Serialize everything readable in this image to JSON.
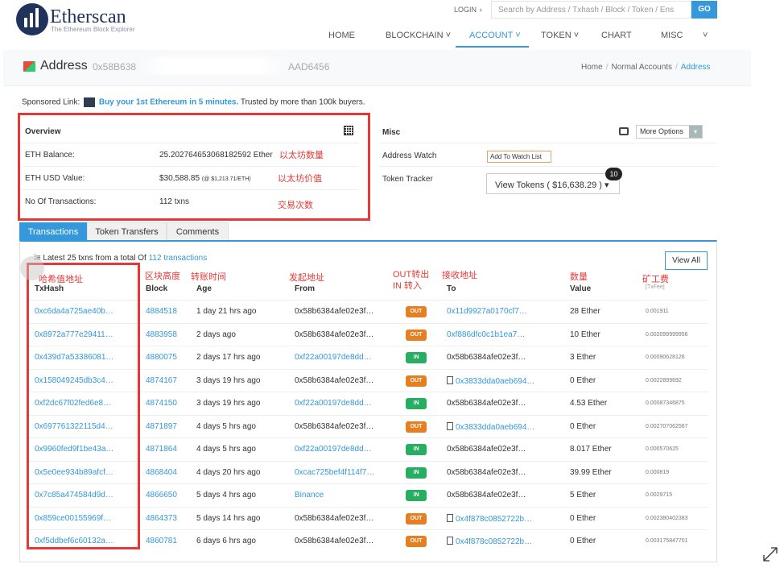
{
  "header": {
    "logo_name": "Etherscan",
    "logo_tagline": "The Ethereum Block Explorer",
    "login": "LOGIN",
    "search_placeholder": "Search by Address / Txhash / Block / Token / Ens",
    "go": "GO",
    "nav": [
      "HOME",
      "BLOCKCHAIN ˅",
      "ACCOUNT ˅",
      "TOKEN ˅",
      "CHART",
      "MISC",
      "˅"
    ]
  },
  "subheader": {
    "label": "Address",
    "address_prefix": "0x58B638",
    "address_suffix": "AAD6456",
    "breadcrumb": [
      "Home",
      "Normal Accounts",
      "Address"
    ]
  },
  "sponsor": {
    "prefix": "Sponsored Link:",
    "link": "Buy your 1st Ethereum in 5 minutes.",
    "suffix": "Trusted by more than 100k buyers."
  },
  "overview": {
    "title": "Overview",
    "rows": [
      {
        "label": "ETH Balance:",
        "value": "25.202764653068182592 Ether",
        "note": "以太坊数量"
      },
      {
        "label": "ETH USD Value:",
        "value": "$30,588.85",
        "sub": "(@ $1,213.71/ETH)",
        "note": "以太坊价值"
      },
      {
        "label": "No Of Transactions:",
        "value": "112 txns",
        "note": "交易次数"
      }
    ]
  },
  "misc": {
    "title": "Misc",
    "more_options": "More Options",
    "address_watch_label": "Address Watch",
    "watch_button": "Add To Watch List",
    "token_tracker_label": "Token Tracker",
    "tokens_select": "View Tokens ( $16,638.29 )",
    "tokens_badge": "10"
  },
  "tabs": [
    "Transactions",
    "Token Transfers",
    "Comments"
  ],
  "transactions": {
    "latest_prefix": "Latest 25 txns from a total Of",
    "latest_link": "112 transactions",
    "view_all": "View All",
    "annotations": {
      "txhash": "哈希值地址",
      "block": "区块高度",
      "age": "转账时间",
      "from": "发起地址",
      "direction": "OUT转出\nIN 转入",
      "to": "接收地址",
      "value": "数量",
      "fee": "矿工费"
    },
    "headers": {
      "txhash": "TxHash",
      "block": "Block",
      "age": "Age",
      "from": "From",
      "to": "To",
      "value": "Value",
      "fee": "[TxFee]"
    },
    "rows": [
      {
        "hash": "0xc6da4a725ae40b…",
        "block": "4884518",
        "age": "1 day 21 hrs ago",
        "from": "0x58b6384afe02e3f…",
        "dir": "OUT",
        "to": "0x11d9927a0170cf7…",
        "contract": false,
        "value": "28 Ether",
        "fee": "0.001911"
      },
      {
        "hash": "0x8972a777e29411…",
        "block": "4883958",
        "age": "2 days ago",
        "from": "0x58b6384afe02e3f…",
        "dir": "OUT",
        "to": "0xf886dfc0c1b1ea7…",
        "contract": false,
        "value": "10 Ether",
        "fee": "0.002099999956"
      },
      {
        "hash": "0x439d7a53386081…",
        "block": "4880075",
        "age": "2 days 17 hrs ago",
        "from": "0xf22a00197de8dd…",
        "dir": "IN",
        "to": "0x58b6384afe02e3f…",
        "contract": false,
        "value": "3 Ether",
        "fee": "0.00090628126"
      },
      {
        "hash": "0x158049245db3c4…",
        "block": "4874167",
        "age": "3 days 19 hrs ago",
        "from": "0x58b6384afe02e3f…",
        "dir": "OUT",
        "to": "0x3833dda0aeb694…",
        "contract": true,
        "value": "0 Ether",
        "fee": "0.0022899692"
      },
      {
        "hash": "0xf2dc67f02fed6e8…",
        "block": "4874150",
        "age": "3 days 19 hrs ago",
        "from": "0xf22a00197de8dd…",
        "dir": "IN",
        "to": "0x58b6384afe02e3f…",
        "contract": false,
        "value": "4.53 Ether",
        "fee": "0.00087346875"
      },
      {
        "hash": "0x697761322115d4…",
        "block": "4871897",
        "age": "4 days 5 hrs ago",
        "from": "0x58b6384afe02e3f…",
        "dir": "OUT",
        "to": "0x3833dda0aeb694…",
        "contract": true,
        "value": "0 Ether",
        "fee": "0.002707062567"
      },
      {
        "hash": "0x9960fed9f1be43a…",
        "block": "4871864",
        "age": "4 days 5 hrs ago",
        "from": "0xf22a00197de8dd…",
        "dir": "IN",
        "to": "0x58b6384afe02e3f…",
        "contract": false,
        "value": "8.017 Ether",
        "fee": "0.000570625"
      },
      {
        "hash": "0x5e0ee934b89afcf…",
        "block": "4868404",
        "age": "4 days 20 hrs ago",
        "from": "0xcac725bef4f114f7…",
        "dir": "IN",
        "to": "0x58b6384afe02e3f…",
        "contract": false,
        "value": "39.99 Ether",
        "fee": "0.000819"
      },
      {
        "hash": "0x7c85a474584d9d…",
        "block": "4866650",
        "age": "5 days 4 hrs ago",
        "from": "Binance",
        "dir": "IN",
        "to": "0x58b6384afe02e3f…",
        "contract": false,
        "value": "5 Ether",
        "fee": "0.0029715"
      },
      {
        "hash": "0x859ce00155969f…",
        "block": "4864373",
        "age": "5 days 14 hrs ago",
        "from": "0x58b6384afe02e3f…",
        "dir": "OUT",
        "to": "0x4f878c0852722b…",
        "contract": true,
        "value": "0 Ether",
        "fee": "0.002380402383"
      },
      {
        "hash": "0xf5ddbef6c60132a…",
        "block": "4860781",
        "age": "6 days 6 hrs ago",
        "from": "0x58b6384afe02e3f…",
        "dir": "OUT",
        "to": "0x4f878c0852722b…",
        "contract": true,
        "value": "0 Ether",
        "fee": "0.003175847701"
      }
    ]
  }
}
